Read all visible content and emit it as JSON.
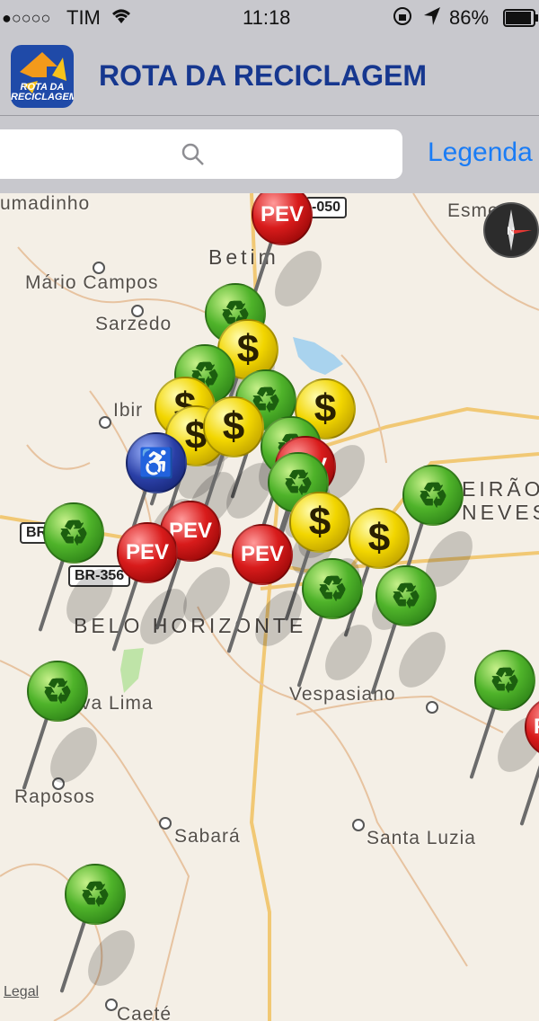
{
  "status_bar": {
    "signal": "●○○○○",
    "carrier": "TIM",
    "wifi_icon": "wifi-icon",
    "time": "11:18",
    "battery": "86%"
  },
  "header": {
    "title": "ROTA DA RECICLAGEM",
    "logo_text": "ROTA DA RECICLAGEM"
  },
  "search": {
    "placeholder": "",
    "legend_button": "Legenda"
  },
  "map": {
    "places": [
      {
        "label": "umadinho"
      },
      {
        "label": "Betim"
      },
      {
        "label": "Mário Campos"
      },
      {
        "label": "Sarzedo"
      },
      {
        "label": "Ibir"
      },
      {
        "label": "Esmer"
      },
      {
        "label": "EIRÃO"
      },
      {
        "label": "NEVES"
      },
      {
        "label": "BELO HORIZONTE"
      },
      {
        "label": "va Lima"
      },
      {
        "label": "Vespasiano"
      },
      {
        "label": "Raposos"
      },
      {
        "label": "Sabará"
      },
      {
        "label": "Santa Luzia"
      },
      {
        "label": "Caeté"
      }
    ],
    "roads": [
      {
        "label": "-050"
      },
      {
        "label": "BR-356"
      },
      {
        "label": "BR"
      }
    ],
    "legal_link": "Legal",
    "pins": {
      "green_symbol": "♻",
      "yellow_symbol": "$",
      "red_label": "PEV",
      "blue_symbol": "♿"
    }
  },
  "colors": {
    "title_blue": "#16378f",
    "link_blue": "#1a7cf5",
    "pin_green": "#4fb32a",
    "pin_yellow": "#f2d600",
    "pin_red": "#d81b1b",
    "pin_blue": "#2a3fa6"
  }
}
